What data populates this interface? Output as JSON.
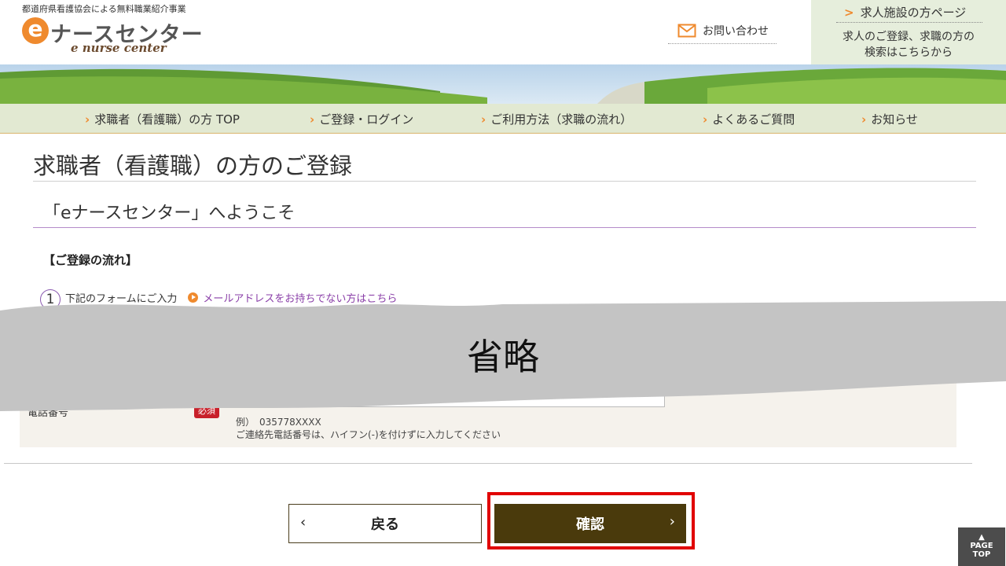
{
  "header": {
    "tagline": "都道府県看護協会による無料職業紹介事業",
    "logo_mark": "e",
    "logo_text": "ナースセンター",
    "logo_sub": "e nurse center",
    "contact_label": "お問い合わせ",
    "facility_link_label": "求人施設の方ページ",
    "facility_desc_line1": "求人のご登録、求職の方の",
    "facility_desc_line2": "検索はこちらから"
  },
  "nav": {
    "items": [
      {
        "label": "求職者（看護職）の方 TOP"
      },
      {
        "label": "ご登録・ログイン"
      },
      {
        "label": "ご利用方法（求職の流れ）"
      },
      {
        "label": "よくあるご質問"
      },
      {
        "label": "お知らせ"
      }
    ]
  },
  "main": {
    "page_title": "求職者（看護職）の方のご登録",
    "welcome": "「eナースセンター」へようこそ",
    "flow_heading": "【ご登録の流れ】",
    "step1_number": "1",
    "step1_label": "下記のフォームにご入力",
    "no_email_link": "メールアドレスをお持ちでない方はこちら",
    "omitted_label": "省略"
  },
  "form": {
    "phone_label": "電話番号",
    "required_badge": "必須",
    "phone_value": "",
    "phone_example": "例）　035778XXXX",
    "phone_hint": "ご連絡先電話番号は、ハイフン(-)を付けずに入力してください"
  },
  "buttons": {
    "back_label": "戻る",
    "confirm_label": "確認",
    "page_top_line1": "PAGE",
    "page_top_line2": "TOP"
  },
  "colors": {
    "accent_orange": "#ef8a2e",
    "confirm_bg": "#4a3a0c",
    "highlight_red": "#e10000",
    "link_purple": "#8a3fa8",
    "required_red": "#c8202a"
  }
}
